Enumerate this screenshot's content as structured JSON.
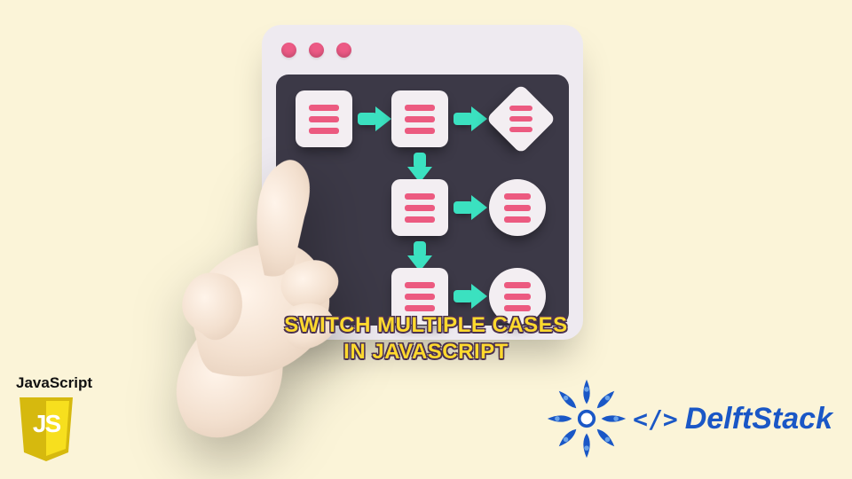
{
  "caption_line1": "Switch Multiple Cases",
  "caption_line2": "in Javascript",
  "js_badge_label": "JavaScript",
  "js_badge_text": "JS",
  "delft_brand": "DelftStack",
  "delft_code": "</>",
  "colors": {
    "background": "#fbf4d8",
    "window_body": "#eeeaf0",
    "window_canvas": "#3c3947",
    "accent_pink": "#ec5a80",
    "accent_teal": "#3be1c0",
    "caption_fill": "#ffd92e",
    "caption_stroke": "#4a3150",
    "delft_blue": "#1a57c6",
    "js_yellow": "#f7df1e",
    "js_dark": "#d6b90e"
  },
  "window": {
    "traffic_dots": 3
  },
  "flowchart": {
    "nodes": [
      {
        "id": "n1",
        "shape": "square",
        "row": 0,
        "col": 0
      },
      {
        "id": "n2",
        "shape": "square",
        "row": 0,
        "col": 1
      },
      {
        "id": "n3",
        "shape": "diamond",
        "row": 0,
        "col": 2
      },
      {
        "id": "n4",
        "shape": "square",
        "row": 1,
        "col": 1
      },
      {
        "id": "n5",
        "shape": "circle",
        "row": 1,
        "col": 2
      },
      {
        "id": "n6",
        "shape": "square",
        "row": 2,
        "col": 1
      },
      {
        "id": "n7",
        "shape": "circle",
        "row": 2,
        "col": 2
      }
    ],
    "arrows": [
      {
        "from": "n1",
        "to": "n2",
        "dir": "right"
      },
      {
        "from": "n2",
        "to": "n3",
        "dir": "right"
      },
      {
        "from": "n2",
        "to": "n4",
        "dir": "down"
      },
      {
        "from": "n4",
        "to": "n5",
        "dir": "right"
      },
      {
        "from": "n4",
        "to": "n6",
        "dir": "down"
      },
      {
        "from": "n6",
        "to": "n7",
        "dir": "right"
      }
    ]
  }
}
